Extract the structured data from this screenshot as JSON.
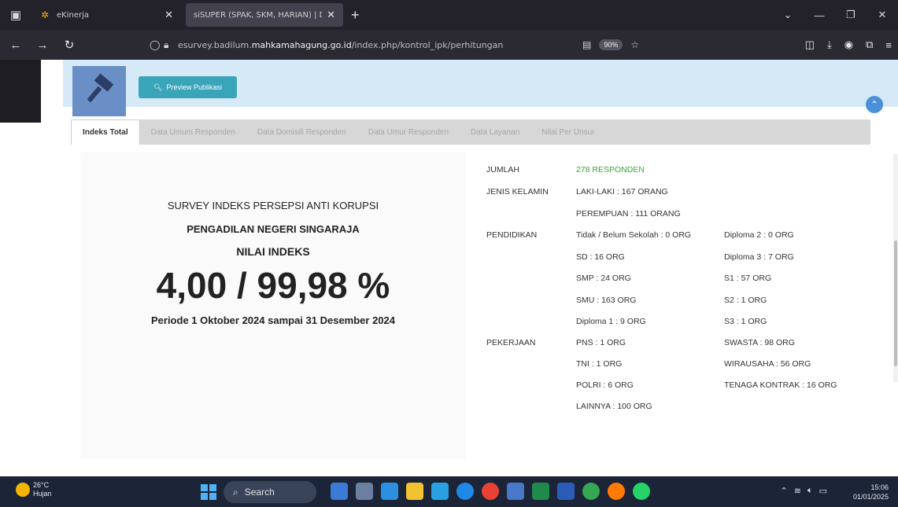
{
  "browser": {
    "tabs": [
      {
        "title": "eKinerja"
      },
      {
        "title": "siSUPER (SPAK, SKM, HARIAN) | Di"
      }
    ],
    "url_prefix": "esurvey.badilum.",
    "url_host": "mahkamahagung.go.id",
    "url_path": "/index.php/kontrol_ipk/perhitungan",
    "zoom": "90%"
  },
  "header": {
    "preview_label": "Preview Publikasi"
  },
  "tabs": [
    {
      "label": "Indeks Total",
      "active": true
    },
    {
      "label": "Data Umum Responden"
    },
    {
      "label": "Data Domisili Responden"
    },
    {
      "label": "Data Umur Responden"
    },
    {
      "label": "Data Layanan"
    },
    {
      "label": "Nilai Per Unsur"
    }
  ],
  "summary": {
    "subtitle": "SURVEY INDEKS PERSEPSI ANTI KORUPSI",
    "court": "PENGADILAN NEGERI SINGARAJA",
    "label": "NILAI INDEKS",
    "value": "4,00 / 99,98 %",
    "period": "Periode 1 Oktober 2024 sampai 31 Desember 2024"
  },
  "stats": {
    "jumlah_label": "JUMLAH",
    "jumlah_value": "278 RESPONDEN",
    "gender_label": "JENIS KELAMIN",
    "male": "LAKI-LAKI : 167 ORANG",
    "female": "PEREMPUAN : 111 ORANG",
    "education_label": "PENDIDIKAN",
    "edu_col1": [
      "Tidak / Belum Sekolah : 0 ORG",
      "SD : 16 ORG",
      "SMP : 24 ORG",
      "SMU : 163 ORG",
      "Diploma 1 : 9 ORG"
    ],
    "edu_col2": [
      "Diploma 2 : 0 ORG",
      "Diploma 3 : 7 ORG",
      "S1 : 57 ORG",
      "S2 : 1 ORG",
      "S3 : 1 ORG"
    ],
    "job_label": "PEKERJAAN",
    "job_col1": [
      "PNS : 1 ORG",
      "TNI : 1 ORG",
      "POLRI : 6 ORG",
      "LAINNYA : 100 ORG"
    ],
    "job_col2": [
      "SWASTA : 98 ORG",
      "WIRAUSAHA : 56 ORG",
      "TENAGA KONTRAK : 16 ORG"
    ]
  },
  "taskbar": {
    "temp": "26°C",
    "weather": "Hujan",
    "search": "Search",
    "time": "15:06",
    "date": "01/01/2025"
  },
  "colors": {
    "accent": "#3aa4b8",
    "header_band": "#d6e9f6",
    "green": "#38a836"
  }
}
